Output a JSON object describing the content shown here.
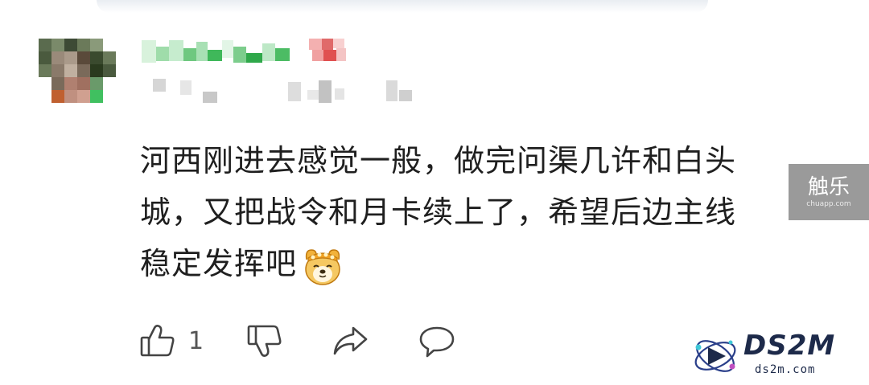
{
  "comment": {
    "line1": "河西刚进去感觉一般，做完问渠几许和白头",
    "line2": "城，又把战令和月卡续上了，希望后边主线",
    "line3": "稳定发挥吧"
  },
  "actions": {
    "like_count": "1"
  },
  "watermarks": {
    "chuyue_title": "触乐",
    "chuyue_url": "chuapp.com",
    "ds2m_logo": "DS2M",
    "ds2m_url": "ds2m.com"
  },
  "icons": {
    "like": "thumbs-up-icon",
    "dislike": "thumbs-down-icon",
    "share": "share-icon",
    "reply": "comment-icon",
    "emoji": "doge-emoji-icon"
  }
}
